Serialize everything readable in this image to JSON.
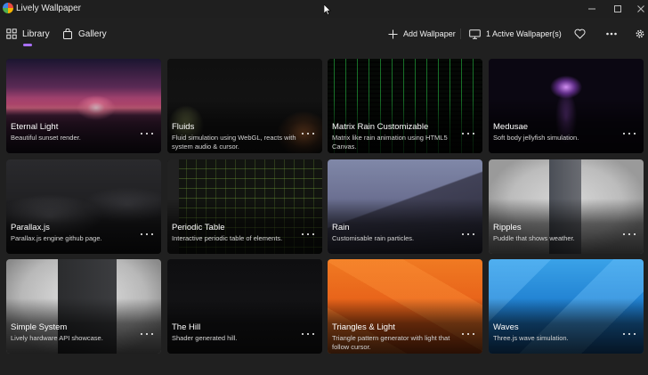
{
  "window": {
    "title": "Lively Wallpaper"
  },
  "nav": {
    "library_label": "Library",
    "gallery_label": "Gallery",
    "active_tab": "Library"
  },
  "commands": {
    "add_wallpaper_label": "Add Wallpaper",
    "active_wallpapers_label": "1 Active Wallpaper(s)"
  },
  "colors": {
    "accent": "#a970ff",
    "background": "#202020"
  },
  "wallpapers": [
    {
      "title": "Eternal Light",
      "description": "Beautiful sunset render."
    },
    {
      "title": "Fluids",
      "description": "Fluid simulation using WebGL, reacts with system audio & cursor."
    },
    {
      "title": "Matrix Rain Customizable",
      "description": "Matrix like rain animation using HTML5 Canvas."
    },
    {
      "title": "Medusae",
      "description": "Soft body jellyfish simulation."
    },
    {
      "title": "Parallax.js",
      "description": "Parallax.js engine github page."
    },
    {
      "title": "Periodic Table",
      "description": "Interactive periodic table of elements."
    },
    {
      "title": "Rain",
      "description": "Customisable rain particles."
    },
    {
      "title": "Ripples",
      "description": "Puddle that shows weather."
    },
    {
      "title": "Simple System",
      "description": "Lively hardware API showcase."
    },
    {
      "title": "The Hill",
      "description": "Shader generated hill."
    },
    {
      "title": "Triangles & Light",
      "description": "Triangle pattern generator with light that follow cursor."
    },
    {
      "title": "Waves",
      "description": "Three.js wave simulation."
    }
  ]
}
